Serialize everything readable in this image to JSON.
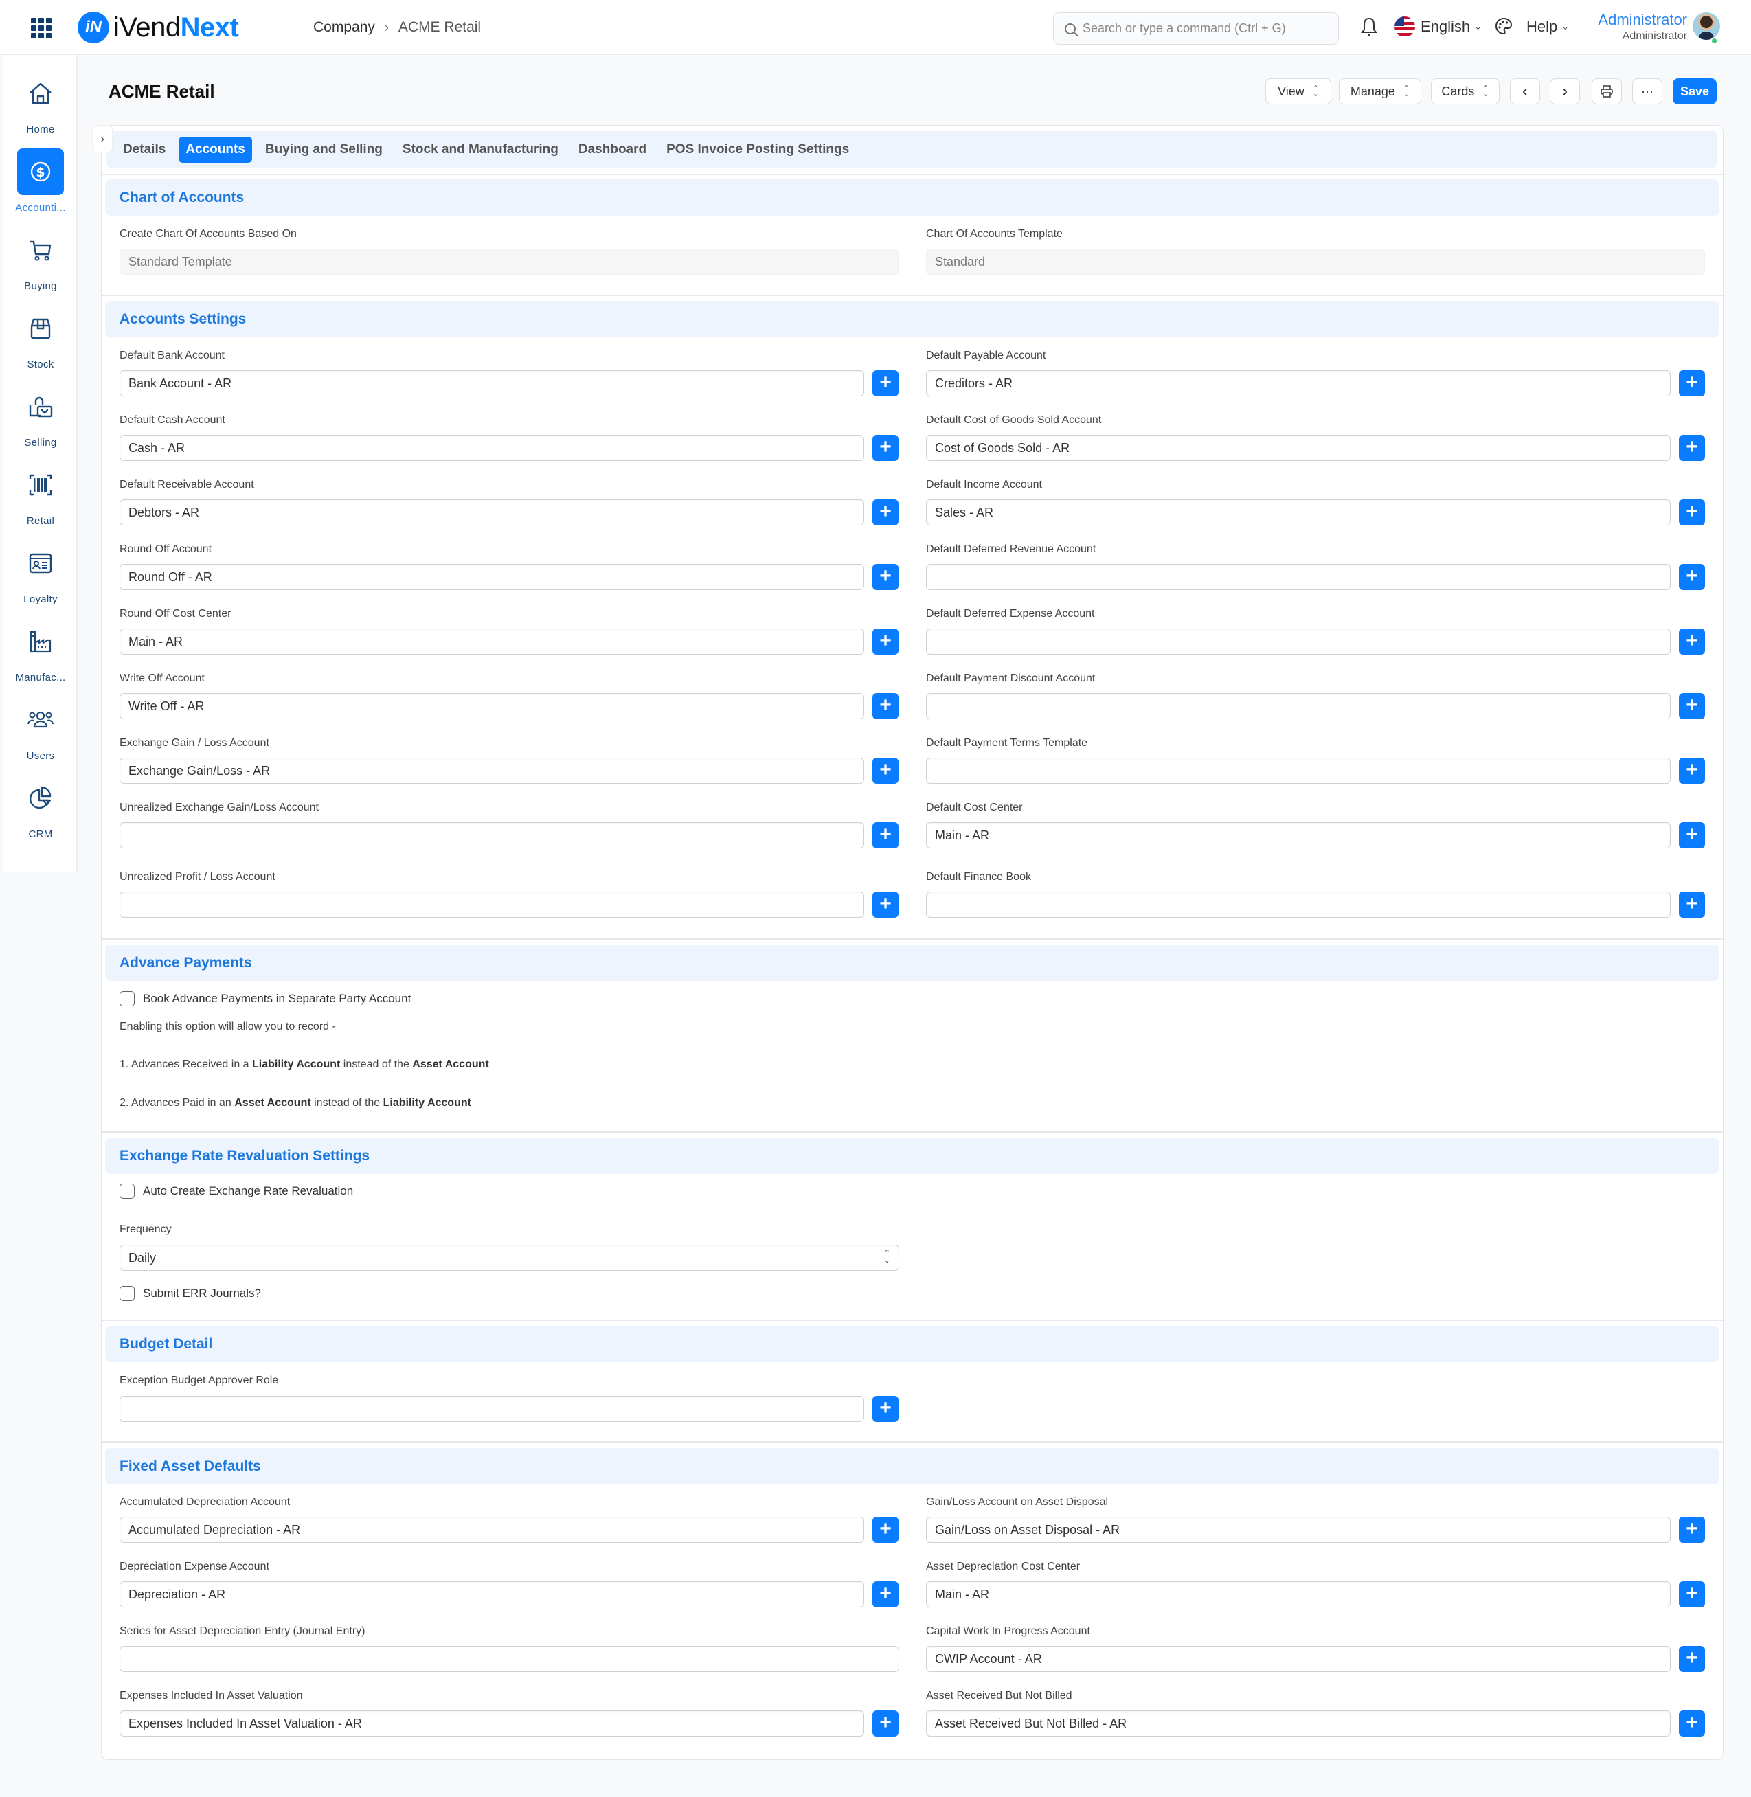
{
  "app": {
    "name_part1": "iVend",
    "name_part2": "Next",
    "logo_mark": "iN"
  },
  "breadcrumb": {
    "parent": "Company",
    "separator": "›",
    "current": "ACME Retail"
  },
  "search": {
    "placeholder": "Search or type a command (Ctrl + G)",
    "value": ""
  },
  "header": {
    "language": "English",
    "help": "Help",
    "user_name": "Administrator",
    "user_role": "Administrator"
  },
  "sidebar": {
    "items": [
      {
        "label": "Home",
        "icon": "home-icon"
      },
      {
        "label": "Accounti...",
        "icon": "dollar-icon",
        "active": true
      },
      {
        "label": "Buying",
        "icon": "cart-icon"
      },
      {
        "label": "Stock",
        "icon": "box-icon"
      },
      {
        "label": "Selling",
        "icon": "bag-icon"
      },
      {
        "label": "Retail",
        "icon": "barcode-icon"
      },
      {
        "label": "Loyalty",
        "icon": "id-card-icon"
      },
      {
        "label": "Manufac...",
        "icon": "factory-icon"
      },
      {
        "label": "Users",
        "icon": "users-icon"
      },
      {
        "label": "CRM",
        "icon": "pie-chart-icon"
      }
    ]
  },
  "page": {
    "title": "ACME Retail"
  },
  "toolbar": {
    "view": "View",
    "manage": "Manage",
    "cards": "Cards",
    "prev": "‹",
    "next": "›",
    "more": "···",
    "save": "Save"
  },
  "tabs": [
    {
      "label": "Details"
    },
    {
      "label": "Accounts",
      "active": true
    },
    {
      "label": "Buying and Selling"
    },
    {
      "label": "Stock and Manufacturing"
    },
    {
      "label": "Dashboard"
    },
    {
      "label": "POS Invoice Posting Settings"
    }
  ],
  "chart_of_accounts": {
    "title": "Chart of Accounts",
    "based_on_label": "Create Chart Of Accounts Based On",
    "based_on_value": "Standard Template",
    "template_label": "Chart Of Accounts Template",
    "template_value": "Standard"
  },
  "accounts_settings": {
    "title": "Accounts Settings",
    "left": [
      {
        "label": "Default Bank Account",
        "value": "Bank Account - AR"
      },
      {
        "label": "Default Cash Account",
        "value": "Cash - AR"
      },
      {
        "label": "Default Receivable Account",
        "value": "Debtors - AR"
      },
      {
        "label": "Round Off Account",
        "value": "Round Off - AR"
      },
      {
        "label": "Round Off Cost Center",
        "value": "Main - AR"
      },
      {
        "label": "Write Off Account",
        "value": "Write Off - AR"
      },
      {
        "label": "Exchange Gain / Loss Account",
        "value": "Exchange Gain/Loss - AR"
      },
      {
        "label": "Unrealized Exchange Gain/Loss Account",
        "value": ""
      },
      {
        "label": "Unrealized Profit / Loss Account",
        "value": ""
      }
    ],
    "right": [
      {
        "label": "Default Payable Account",
        "value": "Creditors - AR"
      },
      {
        "label": "Default Cost of Goods Sold Account",
        "value": "Cost of Goods Sold - AR"
      },
      {
        "label": "Default Income Account",
        "value": "Sales - AR"
      },
      {
        "label": "Default Deferred Revenue Account",
        "value": ""
      },
      {
        "label": "Default Deferred Expense Account",
        "value": ""
      },
      {
        "label": "Default Payment Discount Account",
        "value": ""
      },
      {
        "label": "Default Payment Terms Template",
        "value": ""
      },
      {
        "label": "Default Cost Center",
        "value": "Main - AR"
      },
      {
        "label": "Default Finance Book",
        "value": ""
      }
    ]
  },
  "advance_payments": {
    "title": "Advance Payments",
    "checkbox_label": "Book Advance Payments in Separate Party Account",
    "checked": false,
    "intro": "Enabling this option will allow you to record -",
    "line1_a": "1. Advances Received in a ",
    "line1_b": "Liability Account",
    "line1_c": " instead of the ",
    "line1_d": "Asset Account",
    "line2_a": "2. Advances Paid in an ",
    "line2_b": "Asset Account",
    "line2_c": " instead of the ",
    "line2_d": "Liability Account"
  },
  "exchange_rate": {
    "title": "Exchange Rate Revaluation Settings",
    "auto_create_label": "Auto Create Exchange Rate Revaluation",
    "auto_create_checked": false,
    "frequency_label": "Frequency",
    "frequency_value": "Daily",
    "submit_label": "Submit ERR Journals?",
    "submit_checked": false
  },
  "budget": {
    "title": "Budget Detail",
    "approver_label": "Exception Budget Approver Role",
    "approver_value": ""
  },
  "fixed_asset": {
    "title": "Fixed Asset Defaults",
    "left": [
      {
        "label": "Accumulated Depreciation Account",
        "value": "Accumulated Depreciation - AR"
      },
      {
        "label": "Depreciation Expense Account",
        "value": "Depreciation - AR"
      },
      {
        "label": "Series for Asset Depreciation Entry (Journal Entry)",
        "value": ""
      },
      {
        "label": "Expenses Included In Asset Valuation",
        "value": "Expenses Included In Asset Valuation - AR"
      }
    ],
    "right": [
      {
        "label": "Gain/Loss Account on Asset Disposal",
        "value": "Gain/Loss on Asset Disposal - AR"
      },
      {
        "label": "Asset Depreciation Cost Center",
        "value": "Main - AR"
      },
      {
        "label": "Capital Work In Progress Account",
        "value": "CWIP Account - AR"
      },
      {
        "label": "Asset Received But Not Billed",
        "value": "Asset Received But Not Billed - AR"
      }
    ]
  },
  "colors": {
    "accent": "#0a7cff",
    "section_title": "#1d78dc",
    "section_bg": "#edf4fd"
  }
}
